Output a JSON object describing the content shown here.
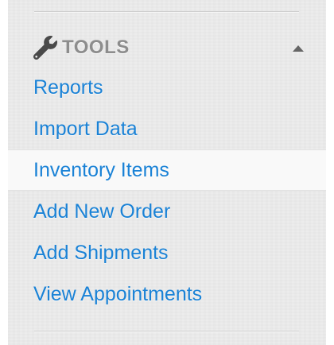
{
  "section": {
    "title": "TOOLS",
    "icon": "wrench-icon",
    "toggle_icon": "caret-up-icon",
    "title_color": "#8d8d8d"
  },
  "menu": {
    "link_color": "#1a82d6",
    "active_index": 2,
    "items": [
      {
        "label": "Reports"
      },
      {
        "label": "Import Data"
      },
      {
        "label": "Inventory Items"
      },
      {
        "label": "Add New Order"
      },
      {
        "label": "Add Shipments"
      },
      {
        "label": "View Appointments"
      }
    ]
  }
}
